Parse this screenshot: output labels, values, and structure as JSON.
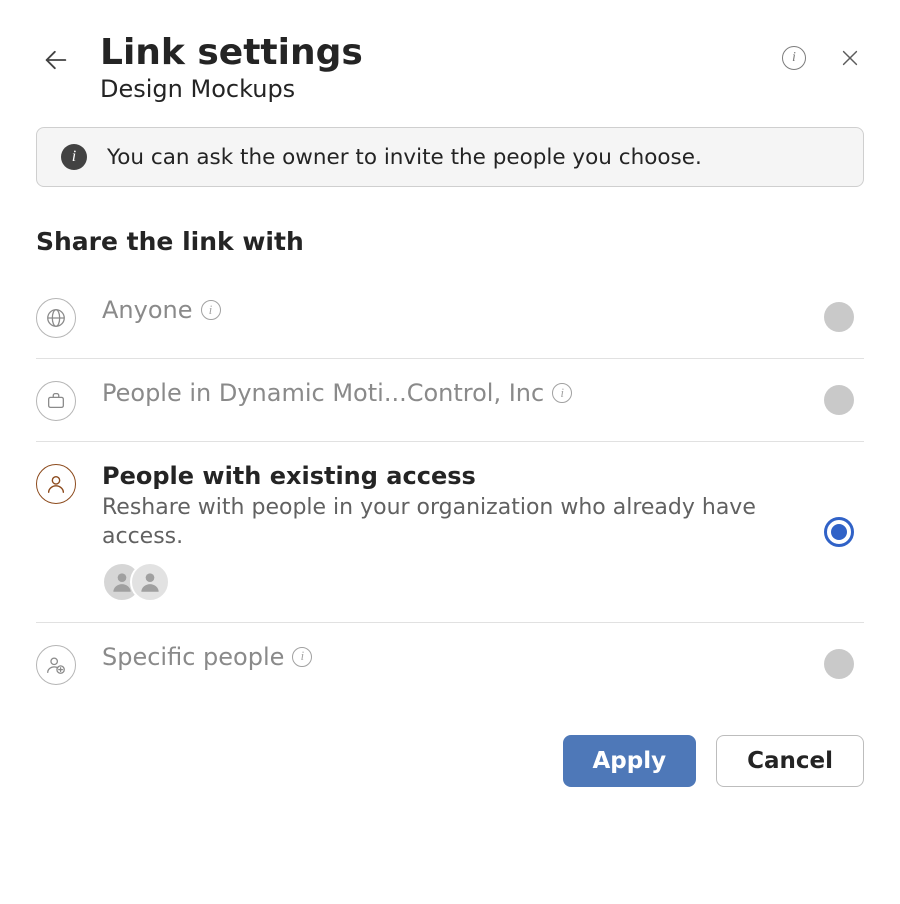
{
  "header": {
    "title": "Link settings",
    "subtitle": "Design Mockups"
  },
  "banner": {
    "text": "You can ask the owner to invite the people you choose."
  },
  "section_title": "Share the link with",
  "options": {
    "anyone": {
      "label": "Anyone"
    },
    "org": {
      "label": "People in Dynamic Moti...Control, Inc"
    },
    "existing": {
      "label": "People with existing access",
      "description": "Reshare with people in your organization who already have access."
    },
    "specific": {
      "label": "Specific people"
    }
  },
  "buttons": {
    "apply": "Apply",
    "cancel": "Cancel"
  }
}
